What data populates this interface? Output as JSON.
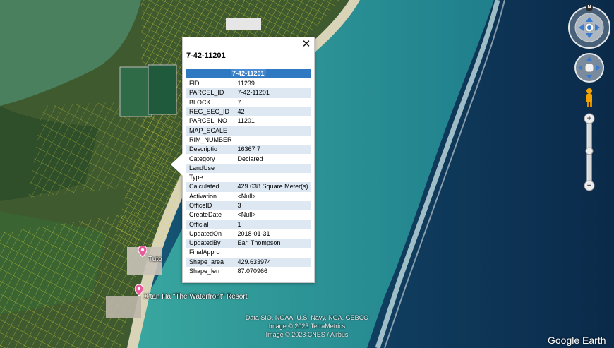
{
  "map": {
    "features": [
      "satellite-imagery",
      "parcel-boundaries",
      "reef",
      "lagoon"
    ]
  },
  "popup": {
    "title": "7-42-11201",
    "header_label": "7-42-11201",
    "close_icon": "close-icon",
    "rows": [
      {
        "key": "FID",
        "value": "11239"
      },
      {
        "key": "PARCEL_ID",
        "value": "7-42-11201"
      },
      {
        "key": "BLOCK",
        "value": "7"
      },
      {
        "key": "REG_SEC_ID",
        "value": "42"
      },
      {
        "key": "PARCEL_NO",
        "value": "11201"
      },
      {
        "key": "MAP_SCALE",
        "value": ""
      },
      {
        "key": "RIM_NUMBER",
        "value": ""
      },
      {
        "key": "Descriptio",
        "value": "16367 7"
      },
      {
        "key": "Category",
        "value": "Declared"
      },
      {
        "key": "LandUse",
        "value": ""
      },
      {
        "key": "Type",
        "value": ""
      },
      {
        "key": "Calculated",
        "value": "429.638 Square Meter(s)"
      },
      {
        "key": "Activation",
        "value": "<Null>"
      },
      {
        "key": "OfficeID",
        "value": "3"
      },
      {
        "key": "CreateDate",
        "value": "<Null>"
      },
      {
        "key": "Official",
        "value": "1"
      },
      {
        "key": "UpdatedOn",
        "value": "2018-01-31"
      },
      {
        "key": "UpdatedBy",
        "value": "Earl Thompson"
      },
      {
        "key": "FinalAppro",
        "value": ""
      },
      {
        "key": "Shape_area",
        "value": "429.633974"
      },
      {
        "key": "Shape_len",
        "value": "87.070966"
      }
    ]
  },
  "placemarks": [
    {
      "label": "Tuto",
      "icon": "placemark-pin-icon"
    },
    {
      "label": "X'tan Ha \"The Waterfront\" Resort",
      "icon": "placemark-pin-icon"
    }
  ],
  "nav": {
    "compass_label": "N",
    "compass_icon": "look-joystick-icon",
    "move_icon": "move-hand-icon",
    "streetview_icon": "pegman-icon",
    "zoom_in": "+",
    "zoom_out": "−"
  },
  "attribution": {
    "line1": "Data SIO, NOAA, U.S. Navy, NGA, GEBCO",
    "line2": "Image © 2023 TerraMetrics",
    "line3": "Image © 2023 CNES / Airbus"
  },
  "logo": "Google Earth",
  "colors": {
    "land": "#3f5a2e",
    "deep_ocean": "#0e2f52",
    "reef_water": "#2f9d9c",
    "parcel_line": "#e8e23a",
    "popup_header": "#2f79c2",
    "pin": "#e85b9a"
  }
}
